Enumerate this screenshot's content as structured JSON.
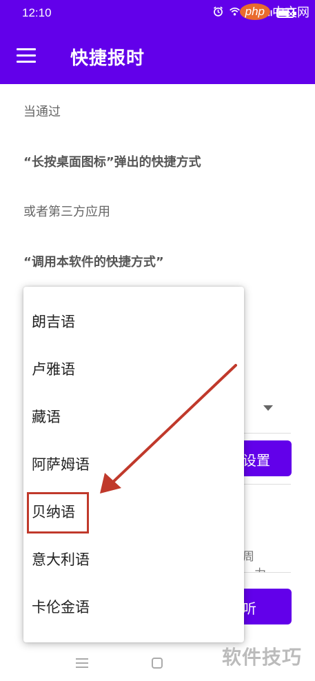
{
  "status_bar": {
    "time": "12:10",
    "icons": [
      "alarm-icon",
      "wifi-icon",
      "hd-icon",
      "4g-signal-icon"
    ],
    "battery": 0.7
  },
  "watermark_top": {
    "php": "php",
    "site": "中文网"
  },
  "app_bar": {
    "title": "快捷报时",
    "menu_icon": "menu-icon"
  },
  "content": {
    "lines": [
      "当通过",
      "“长按桌面图标”弹出的快捷方式",
      "或者第三方应用",
      "“调用本软件的快捷方式”"
    ]
  },
  "background": {
    "button1_label": "设置",
    "button2_label": "听",
    "text1": "周",
    "text2": "一力"
  },
  "dropdown": {
    "options": [
      "朗吉语",
      "卢雅语",
      "藏语",
      "阿萨姆语",
      "贝纳语",
      "意大利语",
      "卡伦金语"
    ],
    "highlighted": "贝纳语"
  },
  "annotation": {
    "color": "#c0392b"
  },
  "colors": {
    "primary": "#6200ea",
    "highlight": "#c0392b"
  },
  "watermark_bottom": "软件技巧"
}
